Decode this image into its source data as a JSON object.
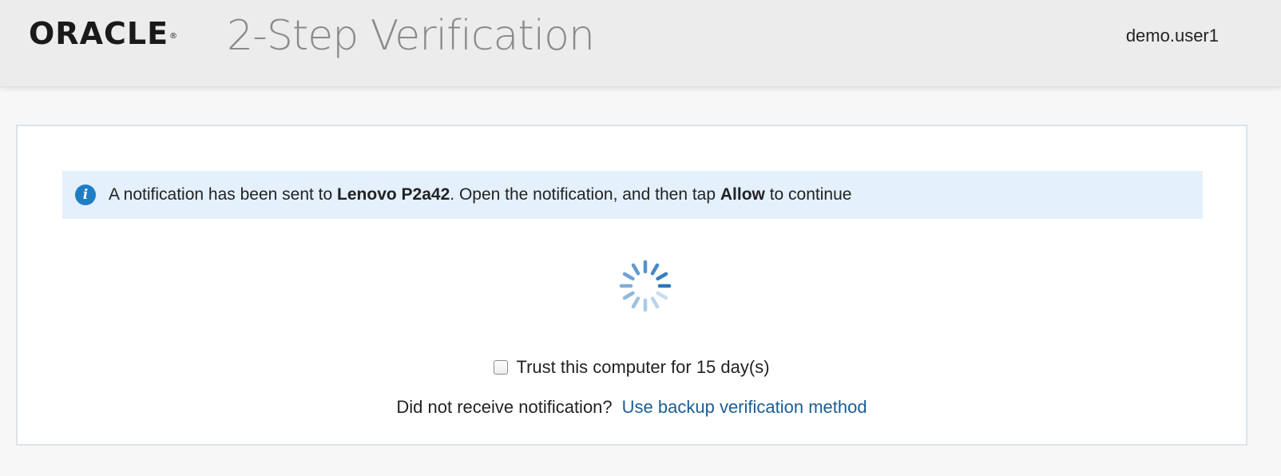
{
  "header": {
    "logo_text": "ORACLE",
    "logo_mark": "®",
    "title": "2-Step Verification",
    "username": "demo.user1"
  },
  "notification": {
    "icon": "info-icon",
    "text_before": "A notification has been sent to ",
    "device_name": "Lenovo P2a42",
    "text_middle": ". Open the notification, and then tap ",
    "action_word": "Allow",
    "text_after": " to continue"
  },
  "status": {
    "spinner": "loading-spinner-icon"
  },
  "trust": {
    "label": "Trust this computer for 15 day(s)",
    "checked": false
  },
  "backup": {
    "prompt": "Did not receive notification?",
    "link_text": "Use backup verification method"
  },
  "colors": {
    "header_bg": "#ececec",
    "page_bg": "#f7f7f7",
    "banner_bg": "#e4f0fb",
    "info_icon": "#1e7ec5",
    "link": "#1b5d94",
    "spinner": "#2a76be"
  }
}
